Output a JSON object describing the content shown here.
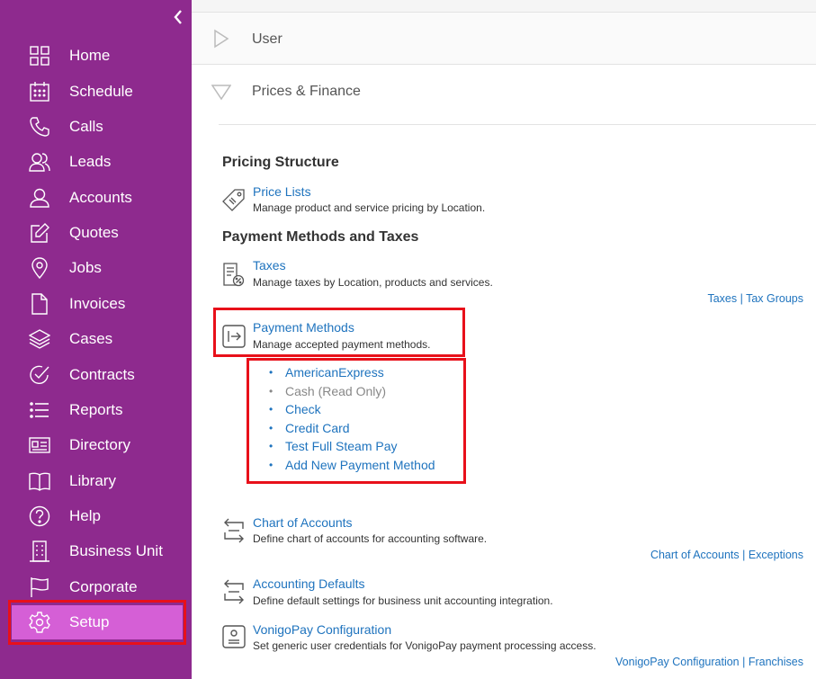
{
  "sidebar": {
    "colors": {
      "background": "#8e2a8e",
      "active": "#d55fd6",
      "highlight": "#e8101a"
    },
    "collapse_icon": "chevron-left-icon",
    "items": [
      {
        "label": "Home",
        "icon": "grid-icon"
      },
      {
        "label": "Schedule",
        "icon": "calendar-icon"
      },
      {
        "label": "Calls",
        "icon": "phone-icon"
      },
      {
        "label": "Leads",
        "icon": "users-icon"
      },
      {
        "label": "Accounts",
        "icon": "user-icon"
      },
      {
        "label": "Quotes",
        "icon": "edit-icon"
      },
      {
        "label": "Jobs",
        "icon": "map-pin-icon"
      },
      {
        "label": "Invoices",
        "icon": "file-icon"
      },
      {
        "label": "Cases",
        "icon": "layers-icon"
      },
      {
        "label": "Contracts",
        "icon": "check-circle-icon"
      },
      {
        "label": "Reports",
        "icon": "list-icon"
      },
      {
        "label": "Directory",
        "icon": "id-card-icon"
      },
      {
        "label": "Library",
        "icon": "book-icon"
      },
      {
        "label": "Help",
        "icon": "help-circle-icon"
      },
      {
        "label": "Business Unit",
        "icon": "building-icon"
      },
      {
        "label": "Corporate",
        "icon": "flag-icon"
      },
      {
        "label": "Setup",
        "icon": "gear-icon",
        "active": true
      }
    ]
  },
  "main": {
    "sections": {
      "user": {
        "title": "User",
        "icon": "triangle-right-icon"
      },
      "prices": {
        "title": "Prices & Finance",
        "icon": "triangle-down-icon"
      }
    },
    "pricing_structure": {
      "heading": "Pricing Structure",
      "price_lists": {
        "title": "Price Lists",
        "desc": "Manage product and service pricing by Location.",
        "icon": "price-tag-icon"
      }
    },
    "payment_taxes": {
      "heading": "Payment Methods and Taxes",
      "taxes": {
        "title": "Taxes",
        "desc": "Manage taxes by Location, products and services.",
        "icon": "tax-document-icon",
        "links": [
          "Taxes",
          "Tax Groups"
        ]
      },
      "payment_methods": {
        "title": "Payment Methods",
        "desc": "Manage accepted payment methods.",
        "icon": "payment-exit-icon",
        "items": [
          {
            "label": "AmericanExpress",
            "read_only": false
          },
          {
            "label": "Cash (Read Only)",
            "read_only": true
          },
          {
            "label": "Check",
            "read_only": false
          },
          {
            "label": "Credit Card",
            "read_only": false
          },
          {
            "label": "Test Full Steam Pay",
            "read_only": false
          },
          {
            "label": "Add New Payment Method",
            "read_only": false
          }
        ]
      }
    },
    "accounting": {
      "chart": {
        "title": "Chart of Accounts",
        "desc": "Define chart of accounts for accounting software.",
        "icon": "transfer-icon",
        "links": [
          "Chart of Accounts",
          "Exceptions"
        ]
      },
      "defaults": {
        "title": "Accounting Defaults",
        "desc": "Define default settings for business unit accounting integration.",
        "icon": "transfer-icon"
      },
      "vonigo": {
        "title": "VonigoPay Configuration",
        "desc": "Set generic user credentials for VonigoPay payment processing access.",
        "icon": "card-terminal-icon",
        "links": [
          "VonigoPay Configuration",
          "Franchises"
        ]
      }
    },
    "link_separator": "|"
  }
}
